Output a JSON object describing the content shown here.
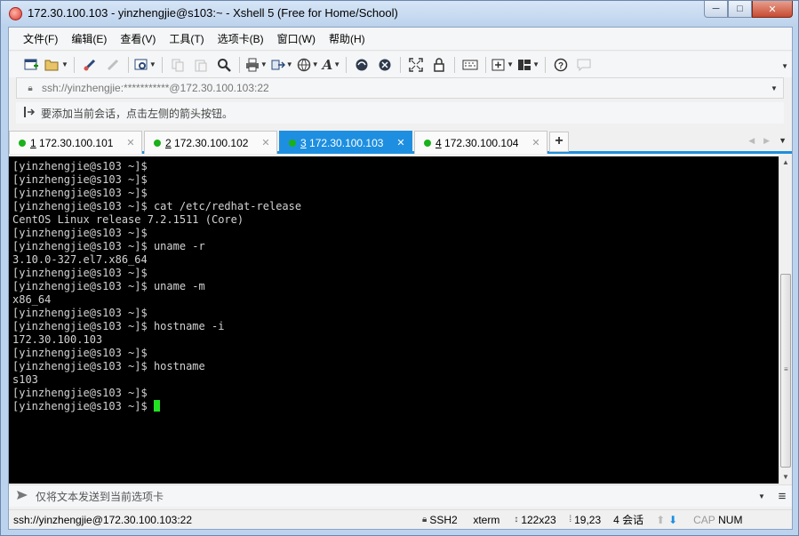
{
  "window": {
    "title": "172.30.100.103 - yinzhengjie@s103:~ - Xshell 5 (Free for Home/School)",
    "minimize": "─",
    "maximize": "□",
    "close": "✕"
  },
  "menu": [
    "文件(F)",
    "编辑(E)",
    "查看(V)",
    "工具(T)",
    "选项卡(B)",
    "窗口(W)",
    "帮助(H)"
  ],
  "address": {
    "value": "ssh://yinzhengjie:***********@172.30.100.103:22"
  },
  "hint": {
    "text": "要添加当前会话，点击左侧的箭头按钮。"
  },
  "tabs": [
    {
      "number": "1",
      "label": "172.30.100.101",
      "active": false
    },
    {
      "number": "2",
      "label": "172.30.100.102",
      "active": false
    },
    {
      "number": "3",
      "label": "172.30.100.103",
      "active": true
    },
    {
      "number": "4",
      "label": "172.30.100.104",
      "active": false
    }
  ],
  "terminal": {
    "lines": [
      "[yinzhengjie@s103 ~]$",
      "[yinzhengjie@s103 ~]$",
      "[yinzhengjie@s103 ~]$",
      "[yinzhengjie@s103 ~]$ cat /etc/redhat-release",
      "CentOS Linux release 7.2.1511 (Core)",
      "[yinzhengjie@s103 ~]$",
      "[yinzhengjie@s103 ~]$ uname -r",
      "3.10.0-327.el7.x86_64",
      "[yinzhengjie@s103 ~]$",
      "[yinzhengjie@s103 ~]$ uname -m",
      "x86_64",
      "[yinzhengjie@s103 ~]$",
      "[yinzhengjie@s103 ~]$ hostname -i",
      "172.30.100.103",
      "[yinzhengjie@s103 ~]$",
      "[yinzhengjie@s103 ~]$ hostname",
      "s103",
      "[yinzhengjie@s103 ~]$",
      "[yinzhengjie@s103 ~]$ "
    ],
    "cursor_color": "#21e221"
  },
  "send": {
    "placeholder": "仅将文本发送到当前选项卡"
  },
  "status": {
    "connection": "ssh://yinzhengjie@172.30.100.103:22",
    "protocol": "SSH2",
    "term": "xterm",
    "size": "122x23",
    "position": "19,23",
    "sessions": "4 会话",
    "cap": "CAP",
    "num": "NUM"
  },
  "colors": {
    "accent": "#1e8fe0",
    "session_dot": "#1ab11a"
  }
}
